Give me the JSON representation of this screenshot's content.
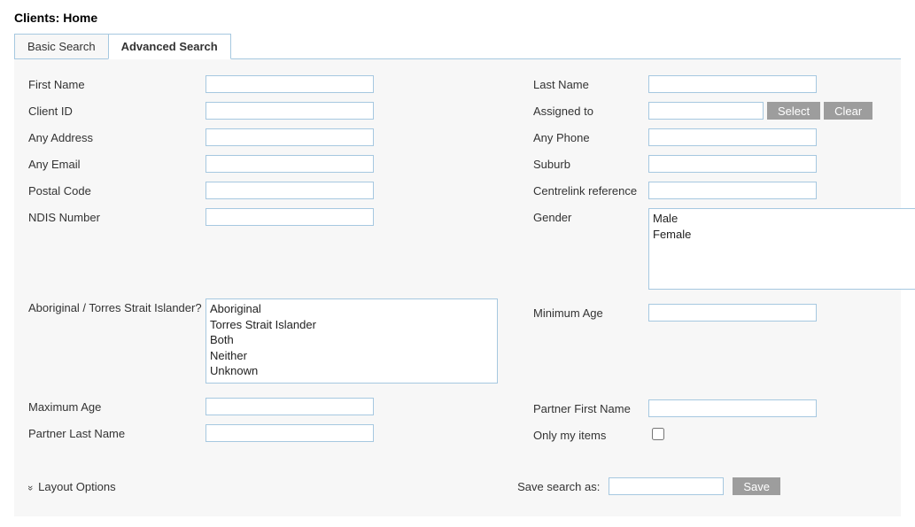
{
  "page_title": "Clients: Home",
  "tabs": {
    "basic": "Basic Search",
    "advanced": "Advanced Search"
  },
  "labels": {
    "first_name": "First Name",
    "last_name": "Last Name",
    "client_id": "Client ID",
    "assigned_to": "Assigned to",
    "any_address": "Any Address",
    "any_phone": "Any Phone",
    "any_email": "Any Email",
    "suburb": "Suburb",
    "postal_code": "Postal Code",
    "centrelink_ref": "Centrelink reference",
    "ndis_number": "NDIS Number",
    "gender": "Gender",
    "atsi": "Aboriginal / Torres Strait Islander?",
    "minimum_age": "Minimum Age",
    "maximum_age": "Maximum Age",
    "partner_first": "Partner First Name",
    "partner_last": "Partner Last Name",
    "only_my_items": "Only my items",
    "layout_options": "Layout Options",
    "save_search_as": "Save search as:"
  },
  "buttons": {
    "select": "Select",
    "clear": "Clear",
    "save": "Save"
  },
  "gender_options": [
    "Male",
    "Female"
  ],
  "atsi_options": [
    "Aboriginal",
    "Torres Strait Islander",
    "Both",
    "Neither",
    "Unknown"
  ],
  "values": {
    "first_name": "",
    "last_name": "",
    "client_id": "",
    "assigned_to": "",
    "any_address": "",
    "any_phone": "",
    "any_email": "",
    "suburb": "",
    "postal_code": "",
    "centrelink_ref": "",
    "ndis_number": "",
    "minimum_age": "",
    "maximum_age": "",
    "partner_first": "",
    "partner_last": "",
    "only_my_items": false,
    "save_search_as": ""
  }
}
